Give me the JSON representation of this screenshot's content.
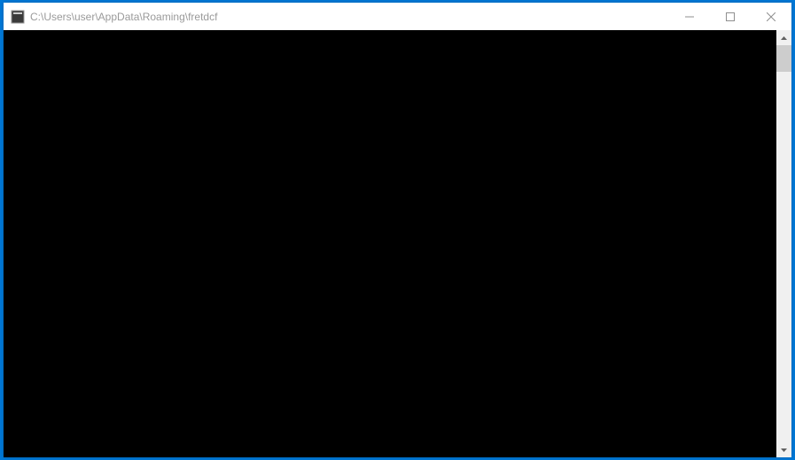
{
  "window": {
    "title": "C:\\Users\\user\\AppData\\Roaming\\fretdcf",
    "controls": {
      "minimize_label": "Minimize",
      "maximize_label": "Maximize",
      "close_label": "Close"
    }
  },
  "console": {
    "content": ""
  },
  "scrollbar": {
    "up_label": "Scroll up",
    "down_label": "Scroll down",
    "thumb_position": 0
  }
}
